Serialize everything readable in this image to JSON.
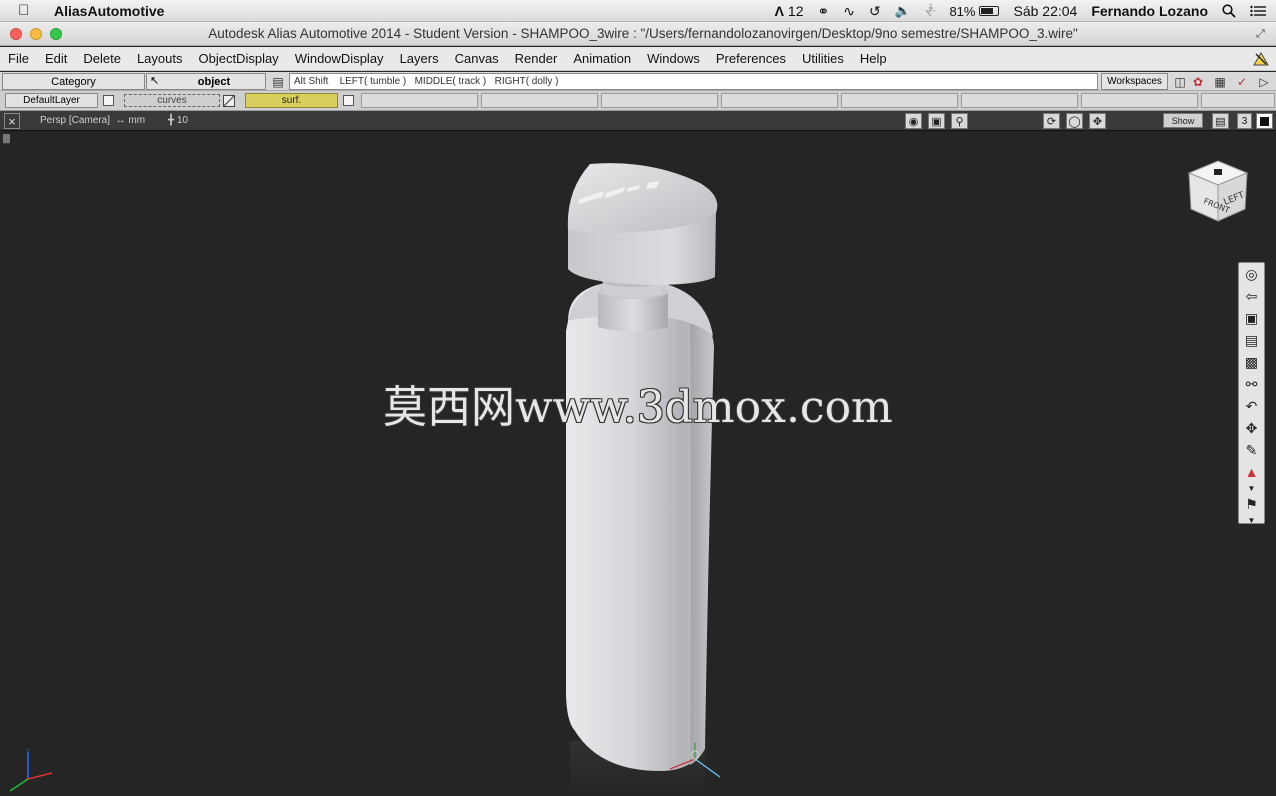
{
  "macos": {
    "app_name": "AliasAutomotive",
    "status": {
      "adobe_count": "12",
      "battery_percent": "81%",
      "clock": "Sáb 22:04",
      "user": "Fernando Lozano"
    }
  },
  "window": {
    "title": "Autodesk Alias Automotive 2014    - Student Version    - SHAMPOO_3wire : \"/Users/fernandolozanovirgen/Desktop/9no semestre/SHAMPOO_3.wire\""
  },
  "menu": {
    "items": [
      "File",
      "Edit",
      "Delete",
      "Layouts",
      "ObjectDisplay",
      "WindowDisplay",
      "Layers",
      "Canvas",
      "Render",
      "Animation",
      "Windows",
      "Preferences",
      "Utilities",
      "Help"
    ]
  },
  "palette": {
    "category_label": "Category",
    "object_label": "object",
    "prompt": "Alt Shift    LEFT( tumble )   MIDDLE( track )   RIGHT( dolly )",
    "workspaces_label": "Workspaces"
  },
  "layers": {
    "default_layer": "DefaultLayer",
    "curves_layer": "curves",
    "surf_layer": "surf.",
    "surf_color": "#d8cf5f"
  },
  "viewport": {
    "camera_label": "Persp [Camera]",
    "units_label": "mm",
    "grid_label": "10",
    "show_label": "Show",
    "layout_number": "3",
    "background_color": "#252525"
  },
  "watermark": {
    "text": "莫西网www.3dmox.com"
  },
  "viewcube": {
    "front_label": "FRONT",
    "left_label": "LEFT"
  },
  "navbar": {
    "icons": [
      "zoom-extents-icon",
      "previous-view-icon",
      "render-view-icon",
      "fit-selection-icon",
      "fit-all-icon",
      "orbit-icon",
      "undo-view-icon",
      "pan-icon",
      "look-at-icon",
      "camera-icon",
      "bookmark-icon"
    ]
  }
}
